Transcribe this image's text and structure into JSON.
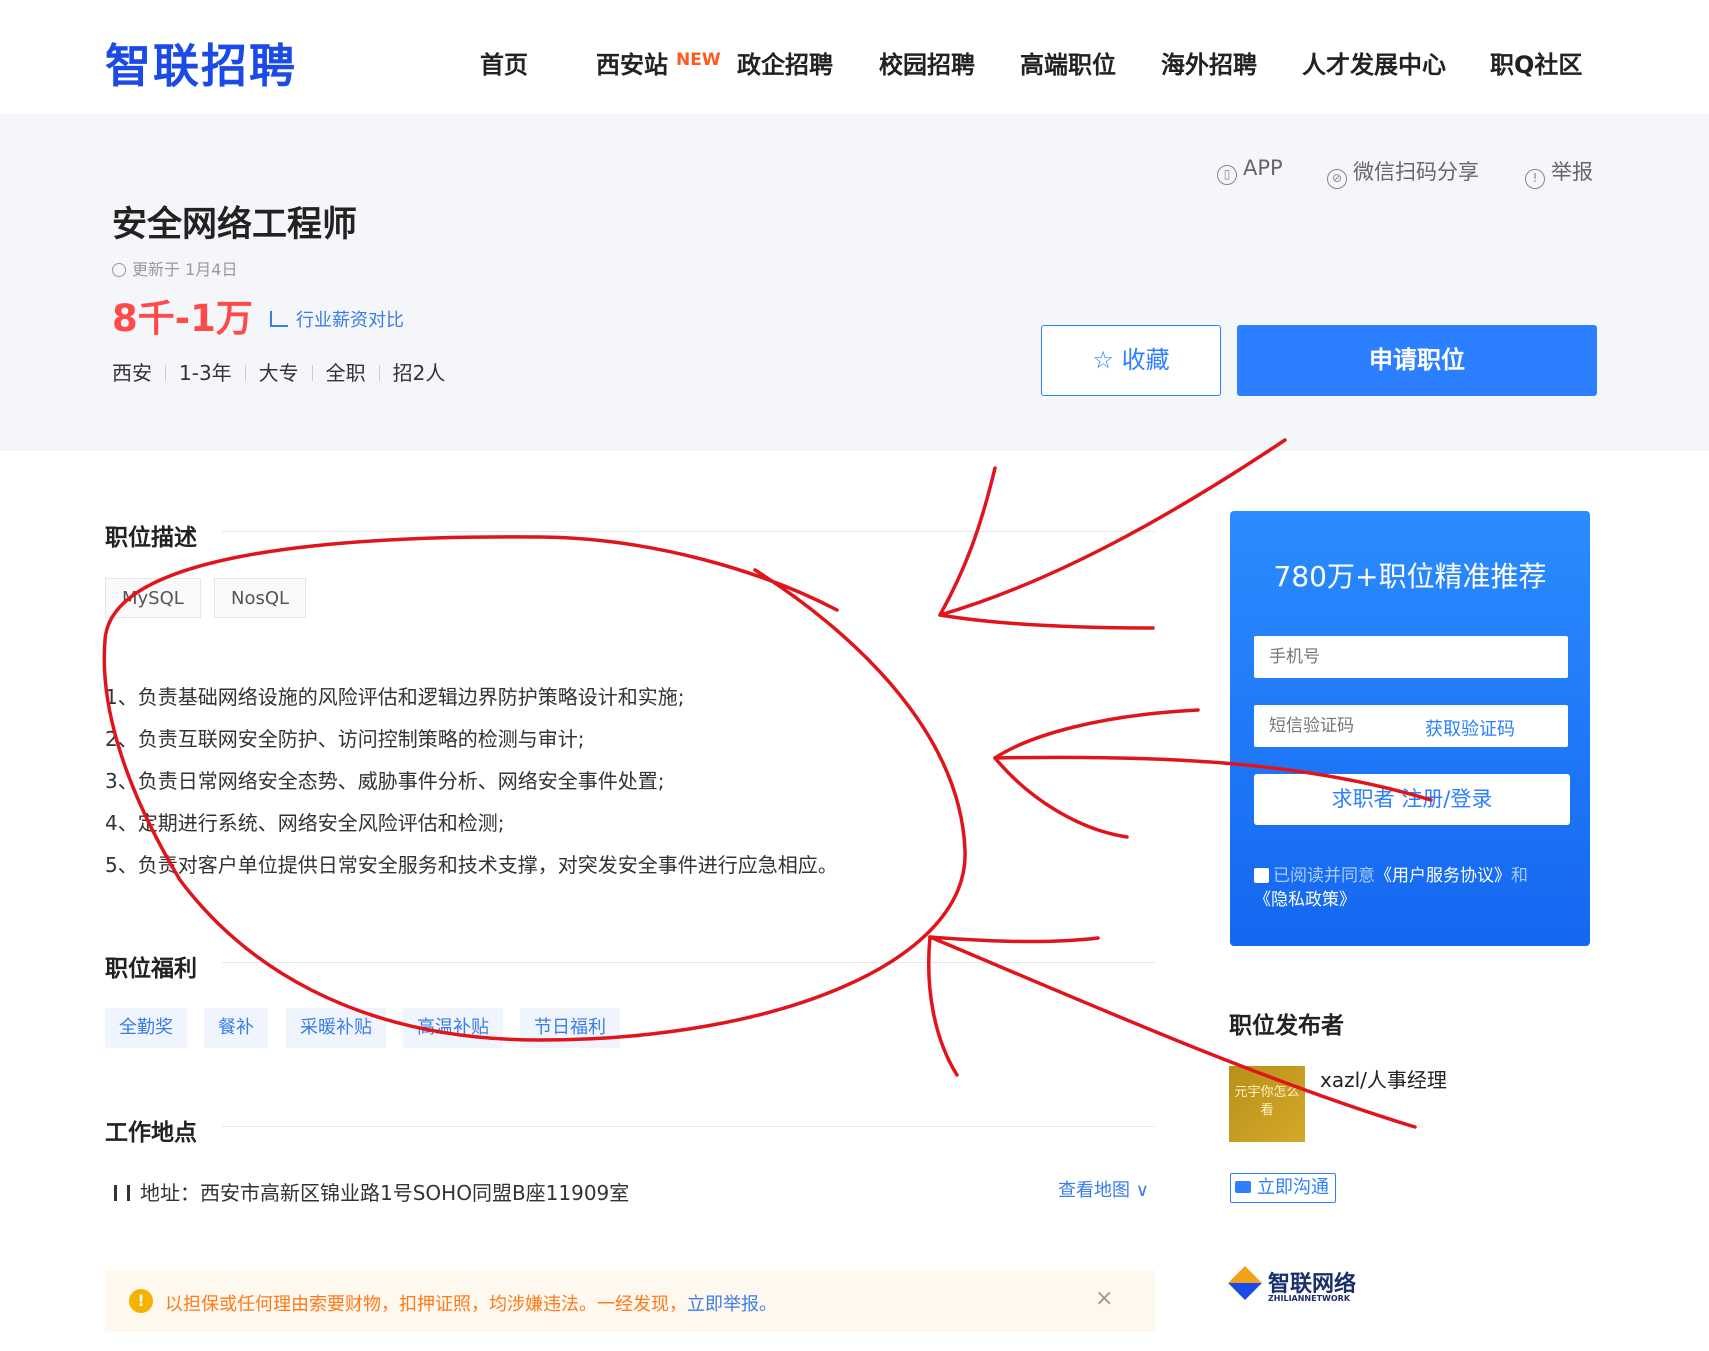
{
  "nav": {
    "logo": "智联招聘",
    "items": [
      "首页",
      "西安站",
      "政企招聘",
      "校园招聘",
      "高端职位",
      "海外招聘",
      "人才发展中心",
      "职Q社区"
    ],
    "new_badge": "NEW"
  },
  "tools": {
    "app": "APP",
    "share": "微信扫码分享",
    "report": "举报"
  },
  "job": {
    "title": "安全网络工程师",
    "updated": "更新于 1月4日",
    "salary": "8千-1万",
    "compare": "行业薪资对比",
    "meta": [
      "西安",
      "1-3年",
      "大专",
      "全职",
      "招2人"
    ]
  },
  "actions": {
    "collect": "收藏",
    "apply": "申请职位"
  },
  "description": {
    "title": "职位描述",
    "skills": [
      "MySQL",
      "NosQL"
    ],
    "lines": [
      "1、负责基础网络设施的风险评估和逻辑边界防护策略设计和实施;",
      "2、负责互联网安全防护、访问控制策略的检测与审计;",
      "3、负责日常网络安全态势、威胁事件分析、网络安全事件处置;",
      "4、定期进行系统、网络安全风险评估和检测;",
      "5、负责对客户单位提供日常安全服务和技术支撑，对突发安全事件进行应急相应。"
    ]
  },
  "welfare": {
    "title": "职位福利",
    "items": [
      "全勤奖",
      "餐补",
      "采暖补贴",
      "高温补贴",
      "节日福利"
    ]
  },
  "location": {
    "title": "工作地点",
    "address": "地址：西安市高新区锦业路1号SOHO同盟B座11909室",
    "map_link": "查看地图"
  },
  "warning": {
    "text": "以担保或任何理由索要财物，扣押证照，均涉嫌违法。一经发现，",
    "link": "立即举报。",
    "close": "×"
  },
  "login_card": {
    "title": "780万+职位精准推荐",
    "phone_placeholder": "手机号",
    "code_placeholder": "短信验证码",
    "get_code": "获取验证码",
    "submit": "求职者 注册/登录",
    "agree_prefix": "已阅读并同意",
    "agreement": "《用户服务协议》",
    "and": "和",
    "privacy": "《隐私政策》"
  },
  "publisher": {
    "title": "职位发布者",
    "name": "xazl/人事经理",
    "avatar_text": "元宇你怎么看",
    "chat": "立即沟通"
  },
  "footer_logo": {
    "name": "智联网络",
    "sub": "ZHILIANNETWORK"
  },
  "colors": {
    "brand": "#1b4ae6",
    "accent": "#2c80ff",
    "salary": "#ff4a4a",
    "annotation": "#e0151b"
  }
}
